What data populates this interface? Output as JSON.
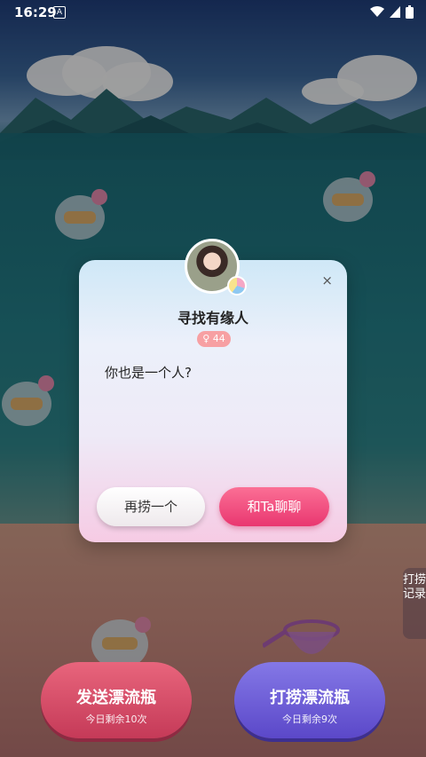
{
  "status_bar": {
    "time": "16:29",
    "notification_icon": "A",
    "icons": [
      "wifi-icon",
      "signal-icon",
      "battery-icon"
    ]
  },
  "side_tab": {
    "label": "打捞记录"
  },
  "bottom_buttons": {
    "send": {
      "label": "发送漂流瓶",
      "sub": "今日剩余10次"
    },
    "fish": {
      "label": "打捞漂流瓶",
      "sub": "今日剩余9次"
    }
  },
  "modal": {
    "close_icon": "×",
    "name": "寻找有缘人",
    "badge": "♀ 44",
    "message": "你也是一个人?",
    "again_button": "再捞一个",
    "chat_button": "和Ta聊聊"
  },
  "colors": {
    "chat_button": "#ea3d74",
    "send_button": "#d94a66",
    "fish_button": "#6a58d6",
    "badge": "#f7a0a3"
  }
}
